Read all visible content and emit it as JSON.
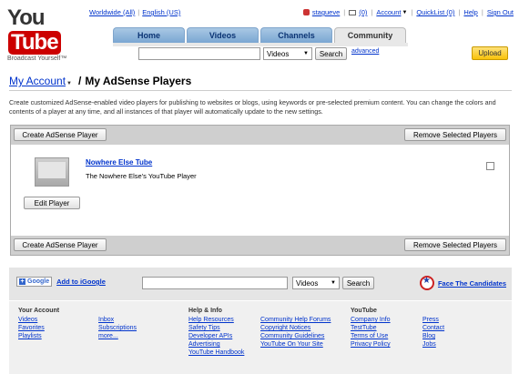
{
  "logo": {
    "you": "You",
    "tube": "Tube",
    "slogan": "Broadcast Yourself™"
  },
  "top_links": {
    "worldwide": "Worldwide (All)",
    "english": "English (US)",
    "username": "stagueve",
    "inbox_count": "(0)",
    "account": "Account",
    "quicklist": "QuickList (0)",
    "help": "Help",
    "sign_out": "Sign Out"
  },
  "nav": {
    "tabs": [
      {
        "label": "Home"
      },
      {
        "label": "Videos"
      },
      {
        "label": "Channels"
      },
      {
        "label": "Community"
      }
    ]
  },
  "search": {
    "category": "Videos",
    "button": "Search",
    "advanced": "advanced"
  },
  "upload": "Upload",
  "heading": {
    "breadcrumb": "My Account",
    "separator": "/",
    "title": "My AdSense Players"
  },
  "description": "Create customized AdSense-enabled video players for publishing to websites or blogs, using keywords or pre-selected premium content. You can change the colors and contents of a player at any time, and all instances of that player will automatically update to the new settings.",
  "panel": {
    "create_button": "Create AdSense Player",
    "remove_button": "Remove Selected Players",
    "player": {
      "name": "Nowhere Else Tube",
      "description": "The Nowhere Else's YouTube Player",
      "edit_button": "Edit Player"
    }
  },
  "footer": {
    "google_label": "Google",
    "add_igoogle": "Add to iGoogle",
    "search_category": "Videos",
    "search_button": "Search",
    "candidates": "Face The Candidates",
    "columns": [
      {
        "head": "Your Account",
        "links": [
          "Videos",
          "Favorites",
          "Playlists"
        ]
      },
      {
        "head": "",
        "links": [
          "Inbox",
          "Subscriptions",
          "more..."
        ]
      },
      {
        "head": "Help & Info",
        "links": [
          "Help Resources",
          "Safety Tips",
          "Developer APIs",
          "Advertising",
          "YouTube Handbook"
        ]
      },
      {
        "head": "",
        "links": [
          "Community Help Forums",
          "Copyright Notices",
          "Community Guidelines",
          "YouTube On Your Site"
        ]
      },
      {
        "head": "YouTube",
        "links": [
          "Company Info",
          "TestTube",
          "Terms of Use",
          "Privacy Policy"
        ]
      },
      {
        "head": "",
        "links": [
          "Press",
          "Contact",
          "Blog",
          "Jobs"
        ]
      }
    ]
  }
}
